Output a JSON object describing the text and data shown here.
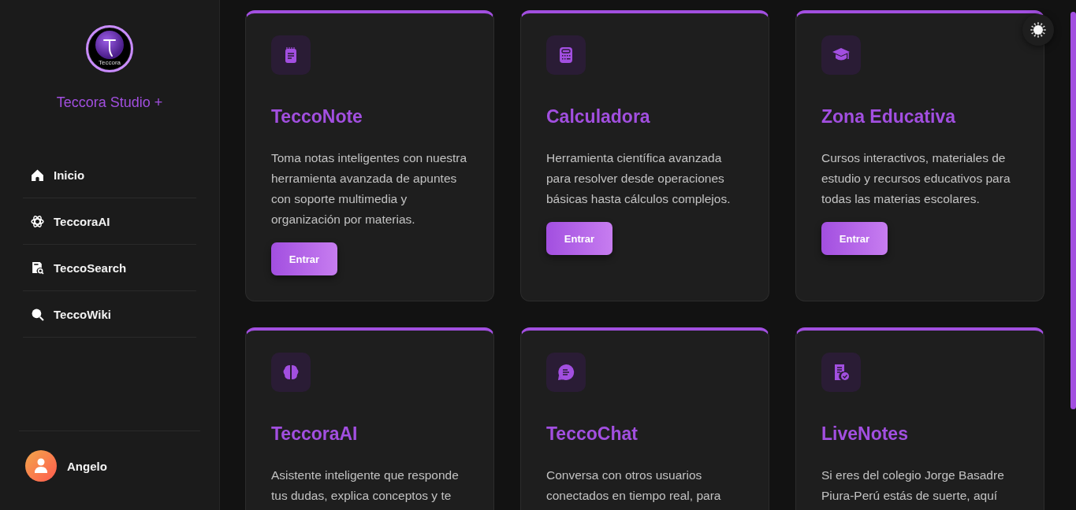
{
  "sidebar": {
    "logo_text": "Teccora",
    "brand": "Teccora Studio +",
    "nav": [
      {
        "label": "Inicio"
      },
      {
        "label": "TeccoraAI"
      },
      {
        "label": "TeccoSearch"
      },
      {
        "label": "TeccoWiki"
      }
    ],
    "user": {
      "name": "Angelo"
    }
  },
  "cards": [
    {
      "title": "TeccoNote",
      "description": "Toma notas inteligentes con nuestra herramienta avanzada de apuntes con soporte multimedia y organización por materias.",
      "button": "Entrar"
    },
    {
      "title": "Calculadora",
      "description": "Herramienta científica avanzada para resolver desde operaciones básicas hasta cálculos complejos.",
      "button": "Entrar"
    },
    {
      "title": "Zona Educativa",
      "description": "Cursos interactivos, materiales de estudio y recursos educativos para todas las materias escolares.",
      "button": "Entrar"
    },
    {
      "title": "TeccoraAI",
      "description": "Asistente inteligente que responde tus dudas, explica conceptos y te"
    },
    {
      "title": "TeccoChat",
      "description": "Conversa con otros usuarios conectados en tiempo real, para"
    },
    {
      "title": "LiveNotes",
      "description": "Si eres del colegio Jorge Basadre Piura-Perú estás de suerte, aquí"
    }
  ]
}
